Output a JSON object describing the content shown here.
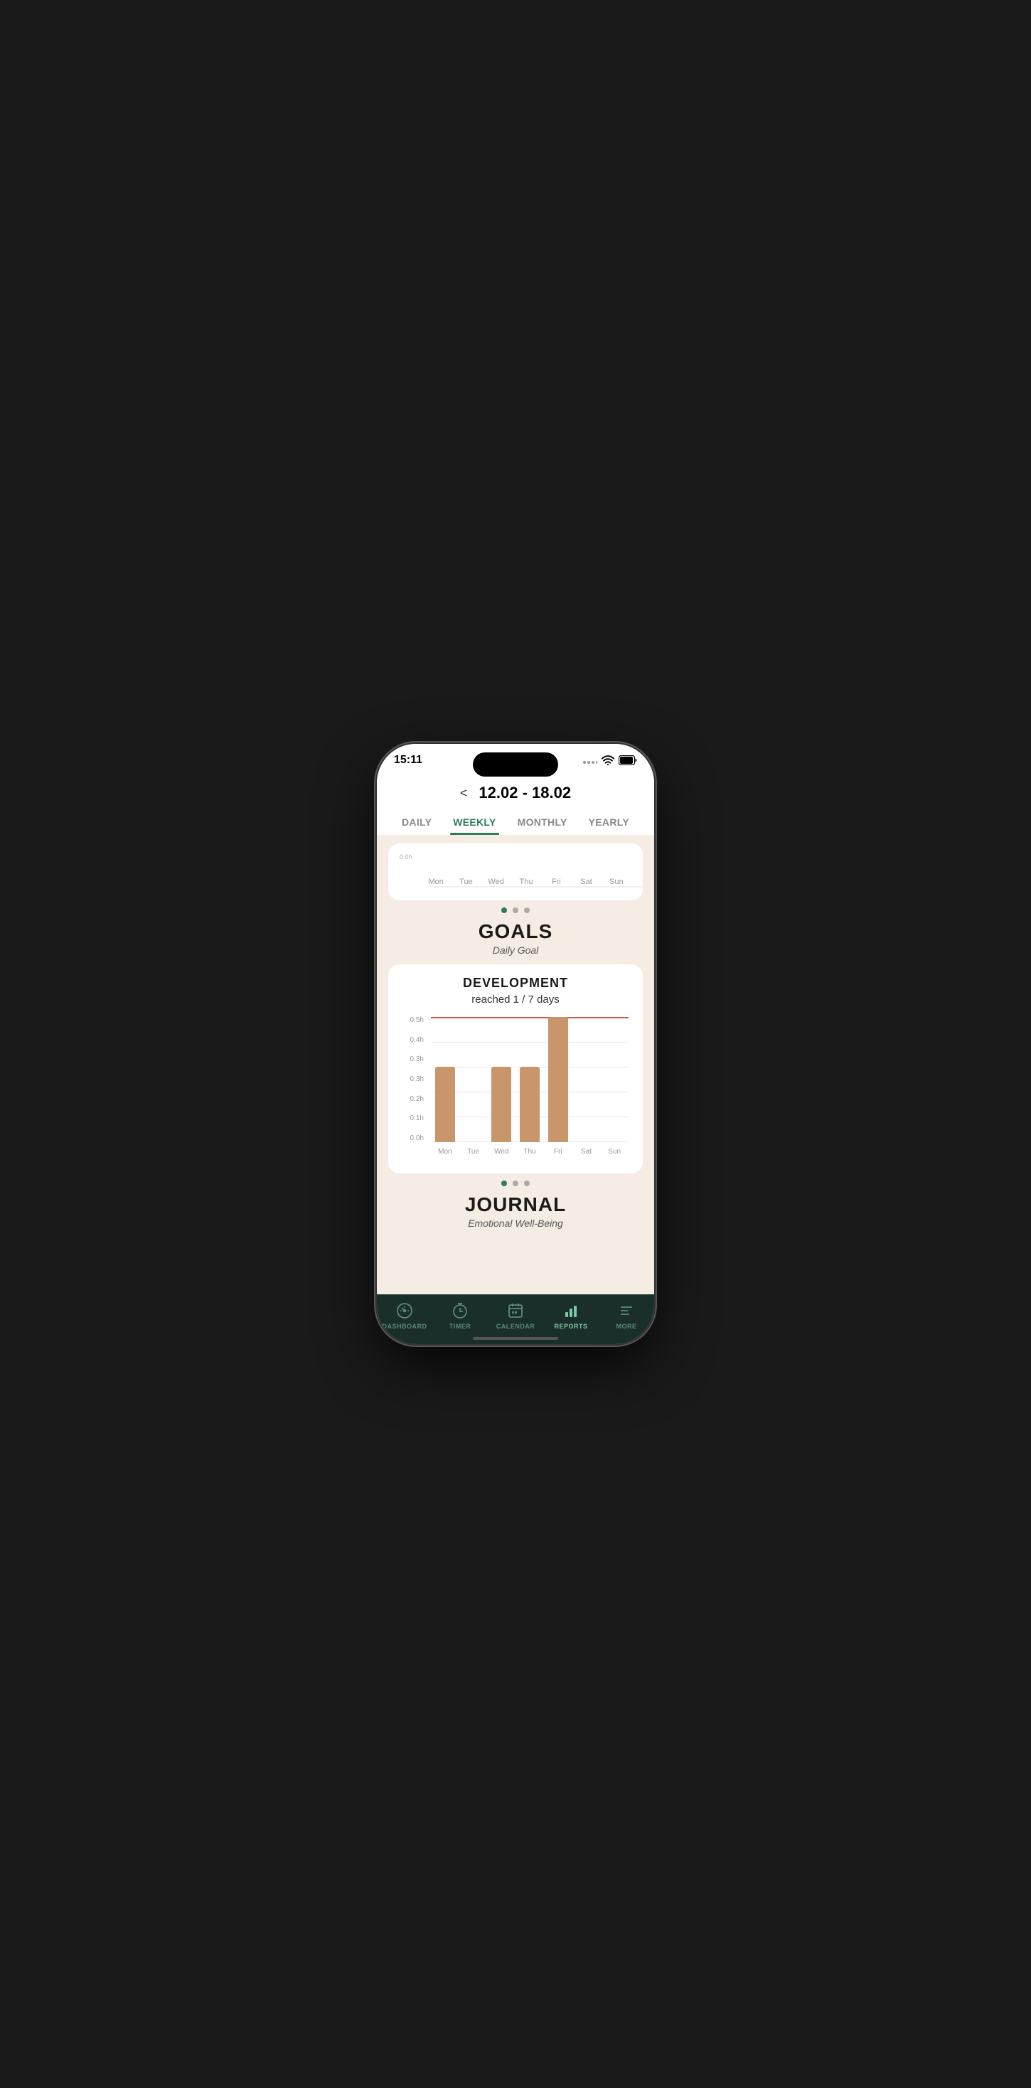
{
  "statusBar": {
    "time": "15:11",
    "wifiIcon": "wifi-icon",
    "batteryIcon": "battery-icon"
  },
  "header": {
    "prevArrow": "<",
    "dateRange": "12.02 - 18.02",
    "tabs": [
      {
        "label": "DAILY",
        "active": false
      },
      {
        "label": "WEEKLY",
        "active": true
      },
      {
        "label": "MONTHLY",
        "active": false
      },
      {
        "label": "YEARLY",
        "active": false
      }
    ]
  },
  "miniChart": {
    "yLabel": "0.0h",
    "days": [
      "Mon",
      "Tue",
      "Wed",
      "Thu",
      "Fri",
      "Sat",
      "Sun"
    ]
  },
  "dots1": [
    {
      "active": true
    },
    {
      "active": false
    },
    {
      "active": false
    }
  ],
  "goalsSection": {
    "title": "GOALS",
    "subtitle": "Daily Goal"
  },
  "developmentChart": {
    "title": "DEVELOPMENT",
    "subtitle": "reached 1 / 7 days",
    "yLabels": [
      "0.5h",
      "0.4h",
      "0.3h",
      "0.3h",
      "0.2h",
      "0.1h",
      "0.0h"
    ],
    "goalLinePercent": 100,
    "days": [
      "Mon",
      "Tue",
      "Wed",
      "Thu",
      "Fri",
      "Sat",
      "Sun"
    ],
    "bars": [
      {
        "day": "Mon",
        "heightPercent": 60
      },
      {
        "day": "Tue",
        "heightPercent": 0
      },
      {
        "day": "Wed",
        "heightPercent": 60
      },
      {
        "day": "Thu",
        "heightPercent": 60
      },
      {
        "day": "Fri",
        "heightPercent": 100
      },
      {
        "day": "Sat",
        "heightPercent": 0
      },
      {
        "day": "Sun",
        "heightPercent": 0
      }
    ]
  },
  "dots2": [
    {
      "active": true
    },
    {
      "active": false
    },
    {
      "active": false
    }
  ],
  "journalSection": {
    "title": "JOURNAL",
    "subtitle": "Emotional Well-Being"
  },
  "bottomNav": [
    {
      "label": "DASHBOARD",
      "icon": "dashboard-icon",
      "active": false
    },
    {
      "label": "TIMER",
      "icon": "timer-icon",
      "active": false
    },
    {
      "label": "CALENDAR",
      "icon": "calendar-icon",
      "active": false
    },
    {
      "label": "REPORTS",
      "icon": "reports-icon",
      "active": true
    },
    {
      "label": "MORE",
      "icon": "more-icon",
      "active": false
    }
  ]
}
